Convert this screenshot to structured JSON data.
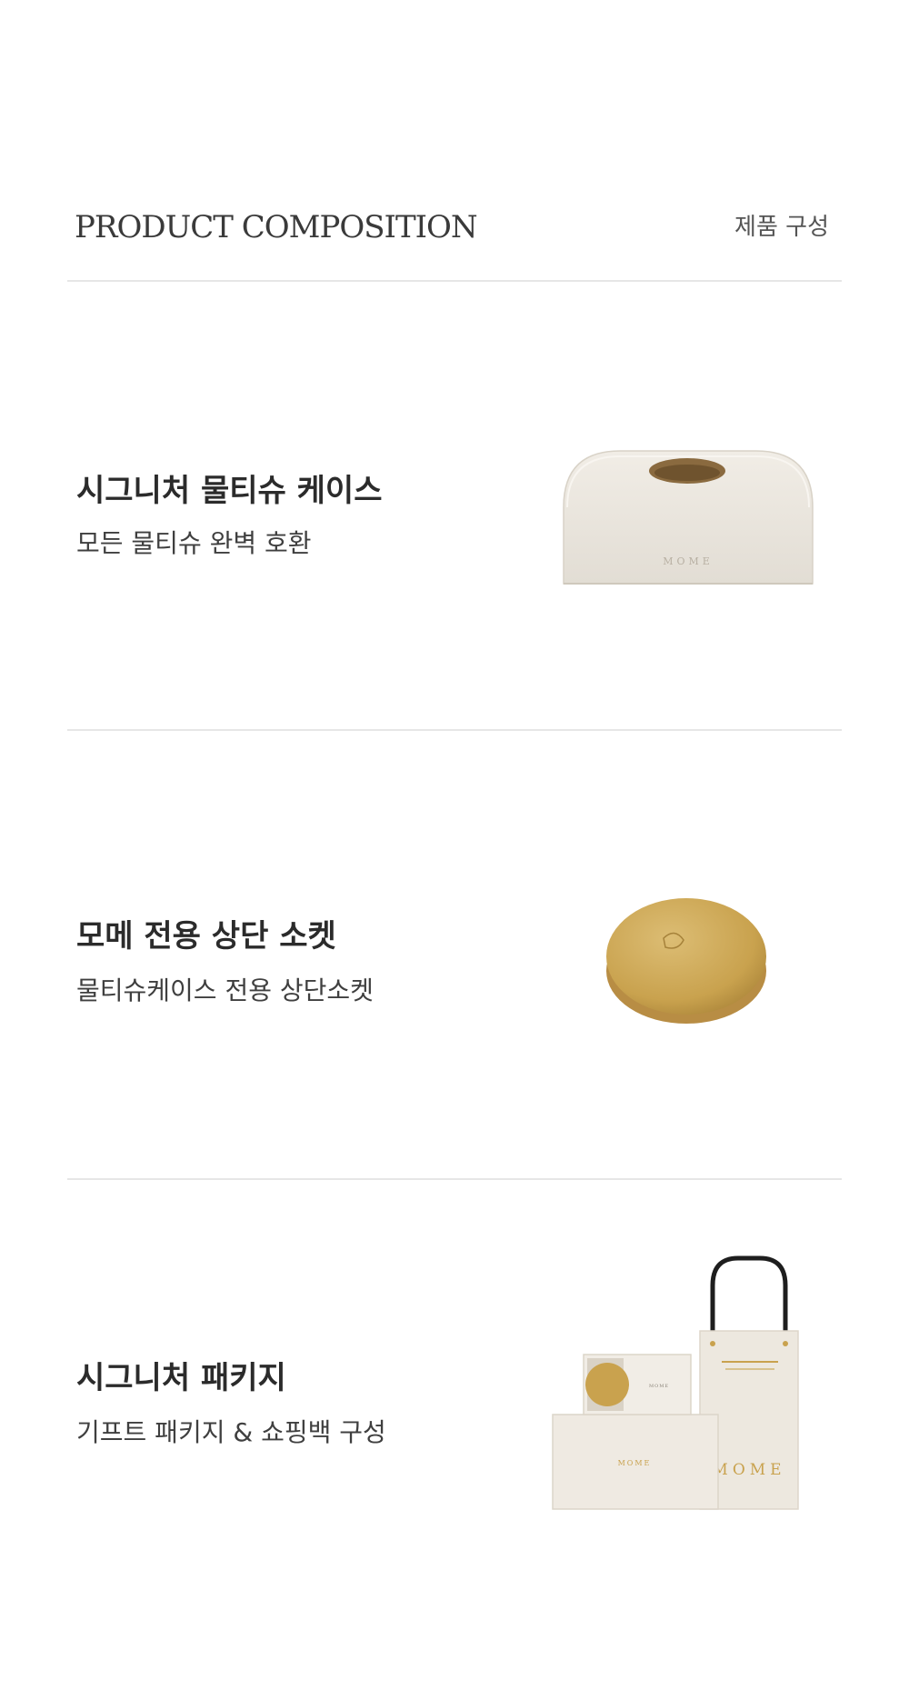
{
  "header": {
    "title": "PRODUCT COMPOSITION",
    "subtitle": "제품 구성"
  },
  "items": [
    {
      "title": "시그니처 물티슈 케이스",
      "description": "모든 물티슈 완벽 호환",
      "image": "tissue-case-illustration",
      "image_text": "MOME"
    },
    {
      "title": "모메 전용 상단 소켓",
      "description": "물티슈케이스 전용 상단소켓",
      "image": "gold-socket-illustration"
    },
    {
      "title": "시그니처 패키지",
      "description": "기프트 패키지 & 쇼핑백 구성",
      "image": "gift-package-illustration",
      "image_text": "MOME"
    }
  ],
  "colors": {
    "background": "#ffffff",
    "divider": "#e6e6e6",
    "cream": "#ece7df",
    "gold": "#c9a24e"
  }
}
